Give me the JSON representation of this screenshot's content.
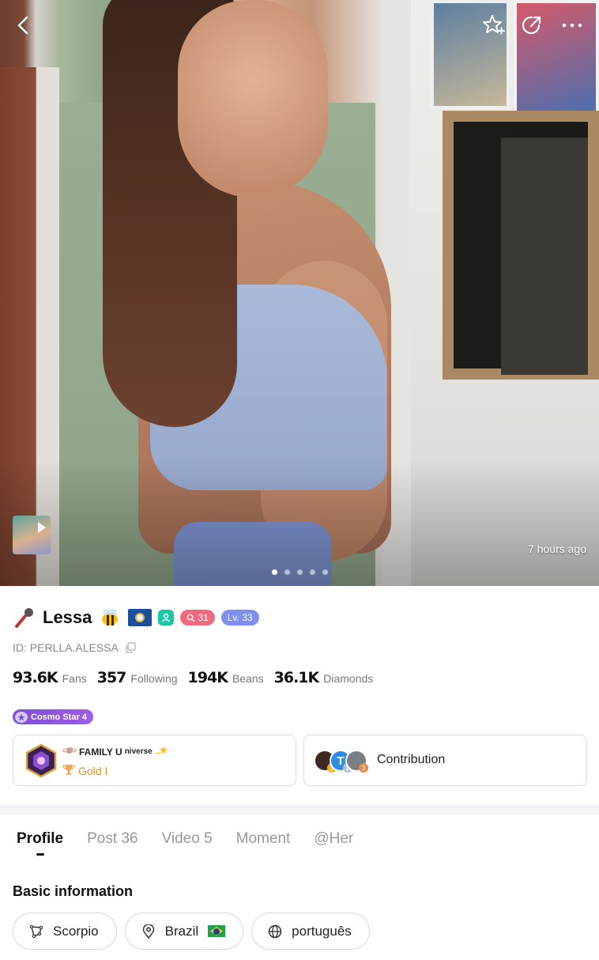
{
  "hero": {
    "time_ago": "7 hours ago",
    "carousel_count": 5,
    "carousel_active_index": 0
  },
  "top_bar": {
    "icons": [
      "back-icon",
      "star-add-icon",
      "share-icon",
      "more-icon"
    ]
  },
  "profile": {
    "name": "Lessa",
    "id_text": "ID: PERLLA.ALESSA",
    "fans_badge": "31",
    "level_badge": "Lv. 33",
    "stats": [
      {
        "value": "93.6K",
        "label": "Fans"
      },
      {
        "value": "357",
        "label": "Following"
      },
      {
        "value": "194K",
        "label": "Beans"
      },
      {
        "value": "36.1K",
        "label": "Diamonds"
      }
    ],
    "cosmo_badge": "Cosmo Star 4"
  },
  "family": {
    "name_prefix": "FAMILY U",
    "name_sup": "niverse",
    "level": "Gold I"
  },
  "contribution": {
    "label": "Contribution",
    "avatar_letter": "T"
  },
  "tabs": [
    {
      "label": "Profile",
      "active": true
    },
    {
      "label": "Post 36",
      "active": false
    },
    {
      "label": "Video 5",
      "active": false
    },
    {
      "label": "Moment",
      "active": false
    },
    {
      "label": "@Her",
      "active": false
    }
  ],
  "basic_info": {
    "title": "Basic information",
    "chips": [
      {
        "icon": "zodiac-icon",
        "label": "Scorpio"
      },
      {
        "icon": "location-icon",
        "label": "Brazil"
      },
      {
        "icon": "globe-icon",
        "label": "português"
      }
    ]
  },
  "colors": {
    "pink_badge": "#f06a7d",
    "level_badge": "#7f8ff0",
    "cosmo": "#8a55e0",
    "gold": "#f08c1d"
  }
}
